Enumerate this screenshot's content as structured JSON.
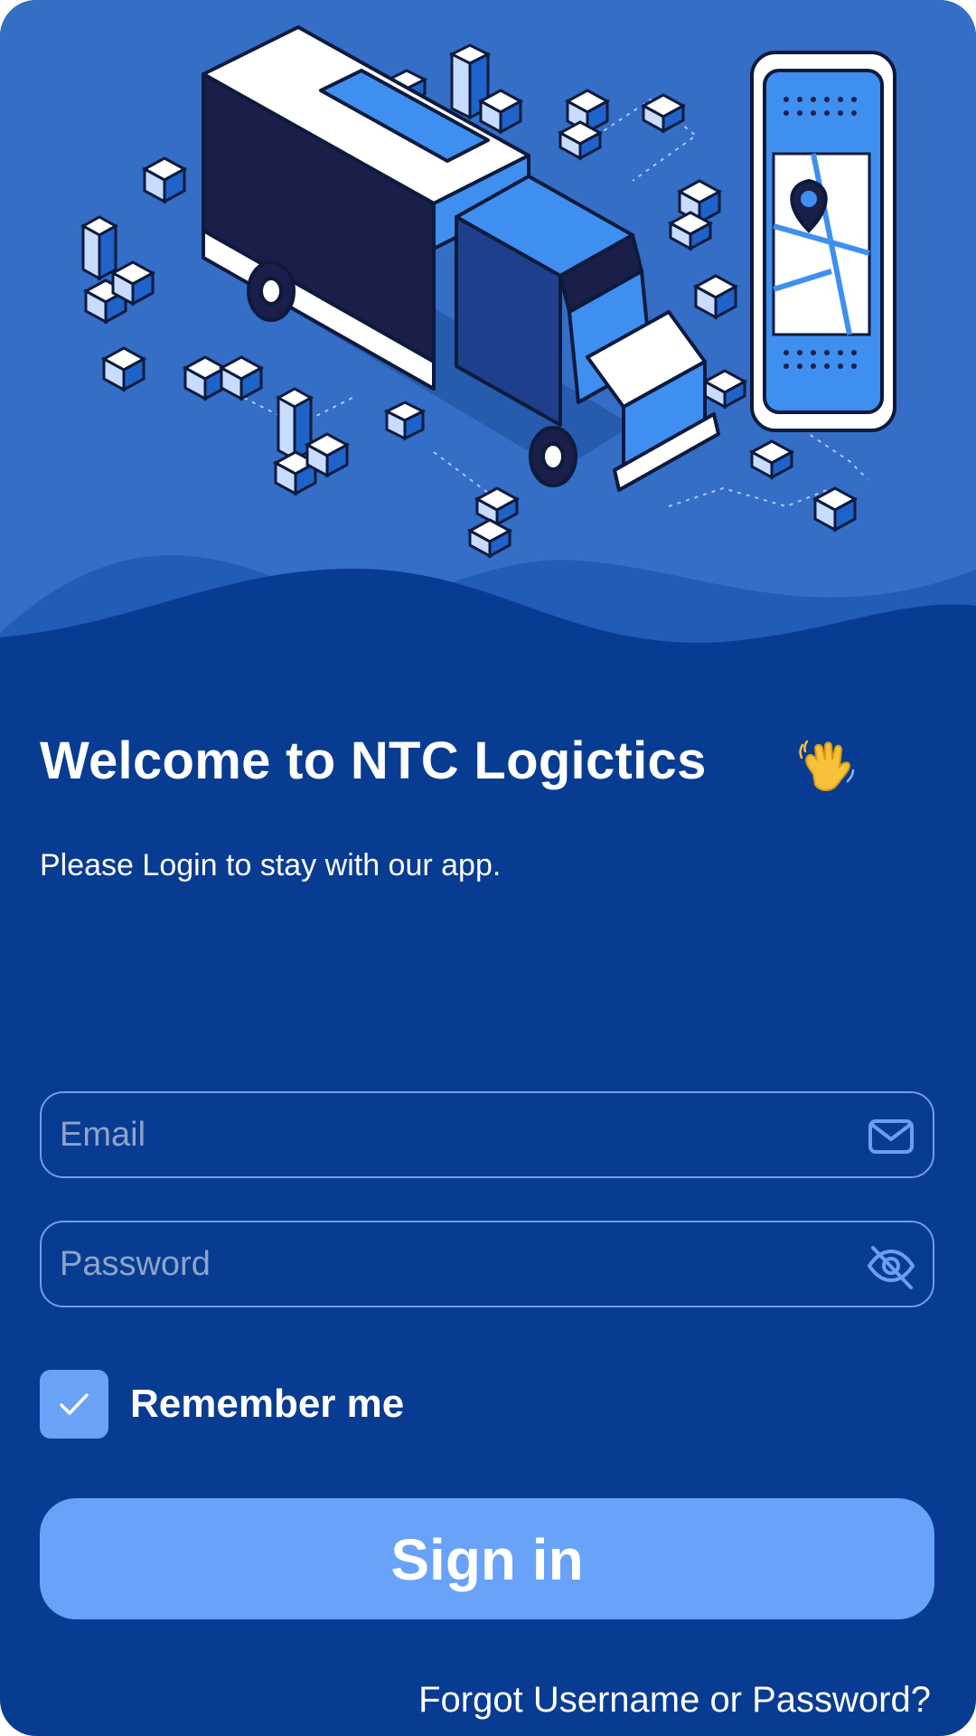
{
  "login": {
    "title": "Welcome to NTC Logictics",
    "subtitle": "Please Login to stay with our app.",
    "email_placeholder": "Email",
    "password_placeholder": "Password",
    "remember_label": "Remember me",
    "remember_checked": true,
    "signin_label": "Sign in",
    "forgot_label": "Forgot Username or Password?"
  },
  "icons": {
    "email": "mail-icon",
    "password": "eye-off-icon",
    "wave": "waving-hand-emoji",
    "check": "check-icon"
  },
  "colors": {
    "background": "#083c92",
    "hero": "#346ec6",
    "accent": "#69a2f9",
    "field_border": "#6c9ff0",
    "placeholder": "#8ea4c8"
  }
}
